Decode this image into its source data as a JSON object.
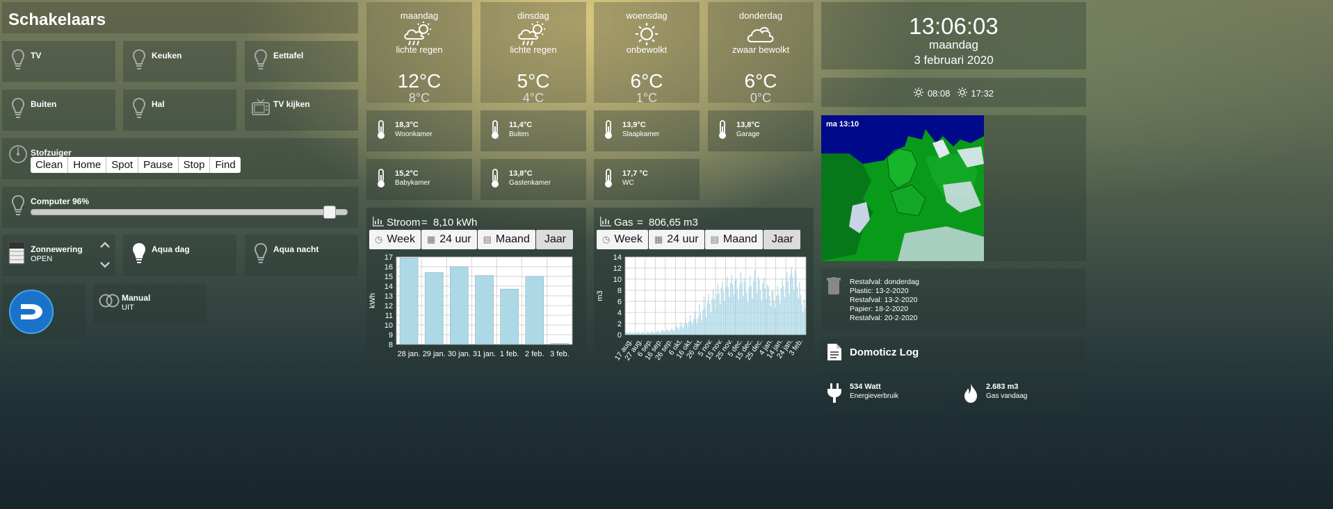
{
  "section_title": "Schakelaars",
  "switches": {
    "tv": {
      "label": "TV"
    },
    "keuken": {
      "label": "Keuken"
    },
    "eettafel": {
      "label": "Eettafel"
    },
    "buiten": {
      "label": "Buiten"
    },
    "hal": {
      "label": "Hal"
    },
    "tvkijken": {
      "label": "TV kijken"
    }
  },
  "vacuum": {
    "title": "Stofzuiger",
    "buttons": [
      "Clean",
      "Home",
      "Spot",
      "Pause",
      "Stop",
      "Find"
    ]
  },
  "dimmer": {
    "title": "Computer 96%",
    "level_percent": 96
  },
  "blinds": {
    "title": "Zonnewering",
    "status": "OPEN"
  },
  "aqua_dag": {
    "label": "Aqua dag"
  },
  "aqua_nacht": {
    "label": "Aqua nacht"
  },
  "manual": {
    "title": "Manual",
    "status": "UIT"
  },
  "forecast": [
    {
      "day": "maandag",
      "desc": "lichte regen",
      "high": "12°C",
      "low": "8°C",
      "icon": "cloud-sun-rain-icon"
    },
    {
      "day": "dinsdag",
      "desc": "lichte regen",
      "high": "5°C",
      "low": "4°C",
      "icon": "cloud-sun-rain-icon"
    },
    {
      "day": "woensdag",
      "desc": "onbewolkt",
      "high": "6°C",
      "low": "1°C",
      "icon": "sun-icon"
    },
    {
      "day": "donderdag",
      "desc": "zwaar bewolkt",
      "high": "6°C",
      "low": "0°C",
      "icon": "cloud-icon"
    }
  ],
  "temperatures": [
    {
      "value": "18,3°C",
      "name": "Woonkamer"
    },
    {
      "value": "11,4°C",
      "name": "Buiten"
    },
    {
      "value": "13,9°C",
      "name": "Slaapkamer"
    },
    {
      "value": "13,8°C",
      "name": "Garage"
    },
    {
      "value": "15,2°C",
      "name": "Babykamer"
    },
    {
      "value": "13,8°C",
      "name": "Gastenkamer"
    },
    {
      "value": "17,7 °C",
      "name": "WC"
    }
  ],
  "clock": {
    "time": "13:06:03",
    "day": "maandag",
    "date": "3 februari 2020"
  },
  "sun": {
    "rise": "08:08",
    "set": "17:32"
  },
  "radar": {
    "timestamp": "ma 13:10"
  },
  "waste": {
    "lines": [
      "Restafval: donderdag",
      "Plastic: 13-2-2020",
      "Restafval: 13-2-2020",
      "Papier: 18-2-2020",
      "Restafval: 20-2-2020"
    ]
  },
  "log": {
    "title": "Domoticz Log"
  },
  "energy": {
    "value": "534 Watt",
    "label": "Energieverbruik"
  },
  "gas_today": {
    "value": "2.683 m3",
    "label": "Gas vandaag"
  },
  "stroom": {
    "title": "Stroom",
    "equals": "=",
    "total": "8,10 kWh",
    "tabs": [
      "Week",
      "24 uur",
      "Maand",
      "Jaar"
    ]
  },
  "gas": {
    "title": "Gas",
    "equals": "=",
    "total": "806,65 m3",
    "tabs": [
      "Week",
      "24 uur",
      "Maand",
      "Jaar"
    ]
  },
  "chart_data": [
    {
      "type": "bar",
      "categories": [
        "28 jan.",
        "29 jan.",
        "30 jan.",
        "31 jan.",
        "1 feb.",
        "2 feb.",
        "3 feb."
      ],
      "values": [
        16.9,
        15.4,
        16.0,
        15.1,
        13.7,
        15.0,
        8.1
      ],
      "ylabel": "kWh",
      "ylim": [
        8,
        17
      ],
      "yticks": [
        8,
        9,
        10,
        11,
        12,
        13,
        14,
        15,
        16,
        17
      ],
      "grid": true,
      "color": "#add8e6"
    },
    {
      "type": "bar",
      "categories": [
        "17 aug.",
        "27 aug.",
        "6 sep.",
        "16 sep.",
        "26 sep.",
        "6 okt.",
        "16 okt.",
        "26 okt.",
        "5 nov.",
        "15 nov.",
        "25 nov.",
        "5 dec.",
        "15 dec.",
        "25 dec.",
        "4 jan.",
        "14 jan.",
        "24 jan.",
        "3 feb."
      ],
      "values": [
        0.4,
        0.3,
        0.5,
        0.2,
        0.6,
        0.3,
        0.4,
        0.2,
        0.5,
        0.3,
        0.4,
        0.6,
        0.3,
        0.2,
        0.4,
        0.5,
        0.3,
        0.4,
        0.2,
        0.6,
        0.5,
        0.3,
        0.4,
        0.7,
        0.5,
        0.3,
        0.4,
        0.6,
        0.8,
        0.5,
        0.4,
        0.7,
        0.9,
        0.6,
        0.5,
        0.8,
        1.0,
        0.7,
        0.6,
        0.9,
        1.2,
        0.8,
        0.7,
        1.0,
        1.6,
        1.2,
        0.9,
        1.4,
        2.2,
        1.5,
        1.1,
        1.8,
        3.0,
        2.0,
        1.4,
        2.4,
        3.5,
        2.4,
        1.8,
        2.8,
        4.2,
        2.8,
        2.0,
        3.2,
        5.5,
        3.8,
        2.6,
        4.5,
        6.8,
        4.8,
        3.2,
        5.8,
        7.4,
        5.6,
        4.0,
        6.5,
        8.2,
        6.4,
        4.8,
        7.2,
        9.2,
        7.5,
        5.5,
        8.4,
        9.6,
        7.8,
        6.0,
        8.8,
        10.4,
        8.6,
        6.8,
        9.4,
        10.8,
        9.0,
        7.2,
        9.8,
        10.0,
        8.2,
        6.4,
        9.0,
        11.2,
        9.4,
        7.0,
        10.2,
        9.4,
        7.6,
        5.8,
        8.6,
        10.6,
        8.8,
        6.6,
        9.6,
        11.6,
        9.8,
        7.4,
        10.4,
        9.8,
        8.0,
        6.2,
        9.2,
        10.2,
        8.4,
        6.4,
        9.0,
        8.6,
        7.0,
        5.2,
        8.0,
        7.8,
        6.2,
        4.8,
        7.0,
        8.8,
        7.2,
        5.6,
        8.4,
        10.2,
        8.8,
        6.8,
        9.6,
        11.2,
        9.6,
        7.4,
        10.8,
        12.2,
        10.4,
        8.0,
        11.6,
        10.8,
        8.6,
        6.6,
        9.4,
        7.2,
        5.4,
        4.0,
        6.4,
        4.8
      ],
      "ylabel": "m3",
      "ylim": [
        0,
        14
      ],
      "yticks": [
        0,
        2,
        4,
        6,
        8,
        10,
        12,
        14
      ],
      "grid": true,
      "color": "#add8e6"
    }
  ]
}
